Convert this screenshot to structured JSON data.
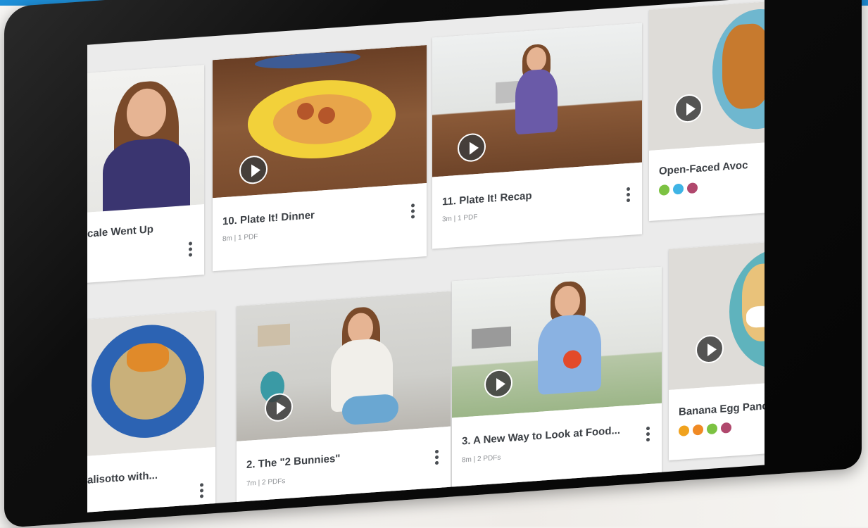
{
  "cards": [
    {
      "title": "cale Went Up",
      "meta": ""
    },
    {
      "title": "10. Plate It! Dinner",
      "meta": "8m | 1 PDF"
    },
    {
      "title": "11. Plate It! Recap",
      "meta": "3m | 1 PDF"
    },
    {
      "title": "Open-Faced Avoc",
      "meta": "",
      "dot_colors": [
        "#7cc242",
        "#3fb4e5",
        "#b0486d"
      ]
    },
    {
      "title": "alisotto with...",
      "meta": ""
    },
    {
      "title": "2. The \"2 Bunnies\"",
      "meta": "7m | 2 PDFs"
    },
    {
      "title": "3. A New Way to Look at Food...",
      "meta": "8m | 2 PDFs"
    },
    {
      "title": "Banana Egg Panca",
      "meta": "",
      "dot_colors": [
        "#f0a21e",
        "#f08a24",
        "#7cc242",
        "#b0486d"
      ]
    }
  ],
  "icons": {
    "play": "play-icon",
    "menu": "kebab-menu-icon"
  },
  "colors": {
    "accent": "#1e8fd8",
    "bezel": "#0b0b0b"
  }
}
